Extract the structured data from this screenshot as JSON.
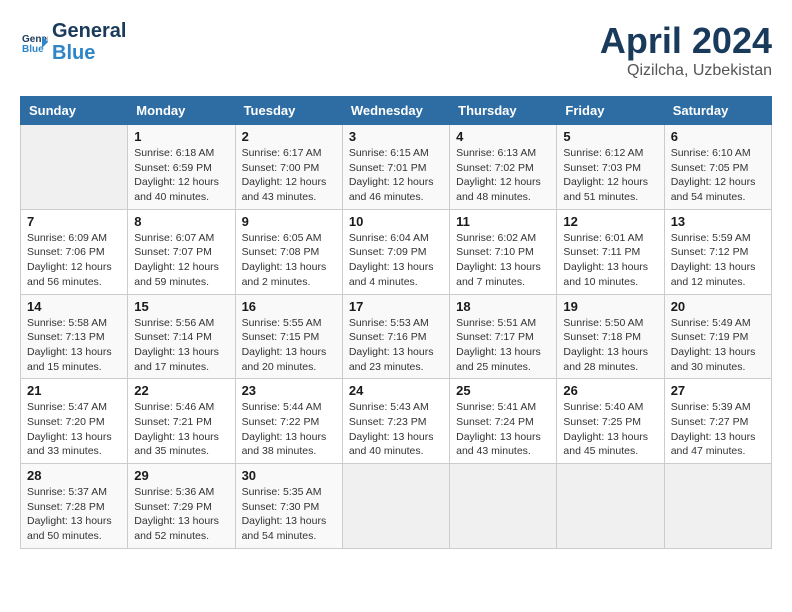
{
  "header": {
    "logo_line1": "General",
    "logo_line2": "Blue",
    "title": "April 2024",
    "subtitle": "Qizilcha, Uzbekistan"
  },
  "weekdays": [
    "Sunday",
    "Monday",
    "Tuesday",
    "Wednesday",
    "Thursday",
    "Friday",
    "Saturday"
  ],
  "weeks": [
    [
      {
        "day": "",
        "info": ""
      },
      {
        "day": "1",
        "info": "Sunrise: 6:18 AM\nSunset: 6:59 PM\nDaylight: 12 hours\nand 40 minutes."
      },
      {
        "day": "2",
        "info": "Sunrise: 6:17 AM\nSunset: 7:00 PM\nDaylight: 12 hours\nand 43 minutes."
      },
      {
        "day": "3",
        "info": "Sunrise: 6:15 AM\nSunset: 7:01 PM\nDaylight: 12 hours\nand 46 minutes."
      },
      {
        "day": "4",
        "info": "Sunrise: 6:13 AM\nSunset: 7:02 PM\nDaylight: 12 hours\nand 48 minutes."
      },
      {
        "day": "5",
        "info": "Sunrise: 6:12 AM\nSunset: 7:03 PM\nDaylight: 12 hours\nand 51 minutes."
      },
      {
        "day": "6",
        "info": "Sunrise: 6:10 AM\nSunset: 7:05 PM\nDaylight: 12 hours\nand 54 minutes."
      }
    ],
    [
      {
        "day": "7",
        "info": "Sunrise: 6:09 AM\nSunset: 7:06 PM\nDaylight: 12 hours\nand 56 minutes."
      },
      {
        "day": "8",
        "info": "Sunrise: 6:07 AM\nSunset: 7:07 PM\nDaylight: 12 hours\nand 59 minutes."
      },
      {
        "day": "9",
        "info": "Sunrise: 6:05 AM\nSunset: 7:08 PM\nDaylight: 13 hours\nand 2 minutes."
      },
      {
        "day": "10",
        "info": "Sunrise: 6:04 AM\nSunset: 7:09 PM\nDaylight: 13 hours\nand 4 minutes."
      },
      {
        "day": "11",
        "info": "Sunrise: 6:02 AM\nSunset: 7:10 PM\nDaylight: 13 hours\nand 7 minutes."
      },
      {
        "day": "12",
        "info": "Sunrise: 6:01 AM\nSunset: 7:11 PM\nDaylight: 13 hours\nand 10 minutes."
      },
      {
        "day": "13",
        "info": "Sunrise: 5:59 AM\nSunset: 7:12 PM\nDaylight: 13 hours\nand 12 minutes."
      }
    ],
    [
      {
        "day": "14",
        "info": "Sunrise: 5:58 AM\nSunset: 7:13 PM\nDaylight: 13 hours\nand 15 minutes."
      },
      {
        "day": "15",
        "info": "Sunrise: 5:56 AM\nSunset: 7:14 PM\nDaylight: 13 hours\nand 17 minutes."
      },
      {
        "day": "16",
        "info": "Sunrise: 5:55 AM\nSunset: 7:15 PM\nDaylight: 13 hours\nand 20 minutes."
      },
      {
        "day": "17",
        "info": "Sunrise: 5:53 AM\nSunset: 7:16 PM\nDaylight: 13 hours\nand 23 minutes."
      },
      {
        "day": "18",
        "info": "Sunrise: 5:51 AM\nSunset: 7:17 PM\nDaylight: 13 hours\nand 25 minutes."
      },
      {
        "day": "19",
        "info": "Sunrise: 5:50 AM\nSunset: 7:18 PM\nDaylight: 13 hours\nand 28 minutes."
      },
      {
        "day": "20",
        "info": "Sunrise: 5:49 AM\nSunset: 7:19 PM\nDaylight: 13 hours\nand 30 minutes."
      }
    ],
    [
      {
        "day": "21",
        "info": "Sunrise: 5:47 AM\nSunset: 7:20 PM\nDaylight: 13 hours\nand 33 minutes."
      },
      {
        "day": "22",
        "info": "Sunrise: 5:46 AM\nSunset: 7:21 PM\nDaylight: 13 hours\nand 35 minutes."
      },
      {
        "day": "23",
        "info": "Sunrise: 5:44 AM\nSunset: 7:22 PM\nDaylight: 13 hours\nand 38 minutes."
      },
      {
        "day": "24",
        "info": "Sunrise: 5:43 AM\nSunset: 7:23 PM\nDaylight: 13 hours\nand 40 minutes."
      },
      {
        "day": "25",
        "info": "Sunrise: 5:41 AM\nSunset: 7:24 PM\nDaylight: 13 hours\nand 43 minutes."
      },
      {
        "day": "26",
        "info": "Sunrise: 5:40 AM\nSunset: 7:25 PM\nDaylight: 13 hours\nand 45 minutes."
      },
      {
        "day": "27",
        "info": "Sunrise: 5:39 AM\nSunset: 7:27 PM\nDaylight: 13 hours\nand 47 minutes."
      }
    ],
    [
      {
        "day": "28",
        "info": "Sunrise: 5:37 AM\nSunset: 7:28 PM\nDaylight: 13 hours\nand 50 minutes."
      },
      {
        "day": "29",
        "info": "Sunrise: 5:36 AM\nSunset: 7:29 PM\nDaylight: 13 hours\nand 52 minutes."
      },
      {
        "day": "30",
        "info": "Sunrise: 5:35 AM\nSunset: 7:30 PM\nDaylight: 13 hours\nand 54 minutes."
      },
      {
        "day": "",
        "info": ""
      },
      {
        "day": "",
        "info": ""
      },
      {
        "day": "",
        "info": ""
      },
      {
        "day": "",
        "info": ""
      }
    ]
  ]
}
